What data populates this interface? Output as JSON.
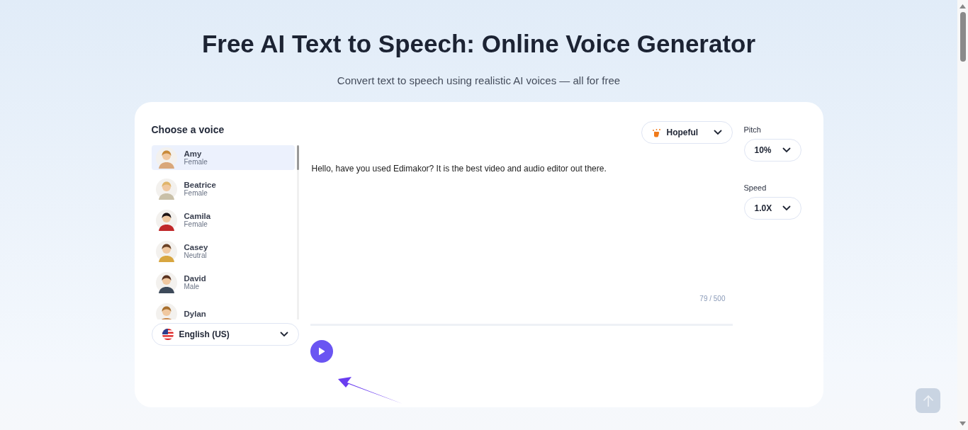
{
  "header": {
    "title": "Free AI Text to Speech: Online Voice Generator",
    "subtitle": "Convert text to speech using realistic AI voices — all for free"
  },
  "voice_panel": {
    "heading": "Choose a voice",
    "voices": [
      {
        "name": "Amy",
        "gender": "Female",
        "selected": true
      },
      {
        "name": "Beatrice",
        "gender": "Female",
        "selected": false
      },
      {
        "name": "Camila",
        "gender": "Female",
        "selected": false
      },
      {
        "name": "Casey",
        "gender": "Neutral",
        "selected": false
      },
      {
        "name": "David",
        "gender": "Male",
        "selected": false
      },
      {
        "name": "Dylan",
        "selected": false
      }
    ],
    "language": "English (US)"
  },
  "editor": {
    "emotion": "Hopeful",
    "text": "Hello, have you used Edimakor? It is the best video and audio editor out there.",
    "counter": "79 / 500"
  },
  "settings": [
    {
      "label": "Pitch",
      "value": "10%"
    },
    {
      "label": "Speed",
      "value": "1.0X"
    }
  ]
}
